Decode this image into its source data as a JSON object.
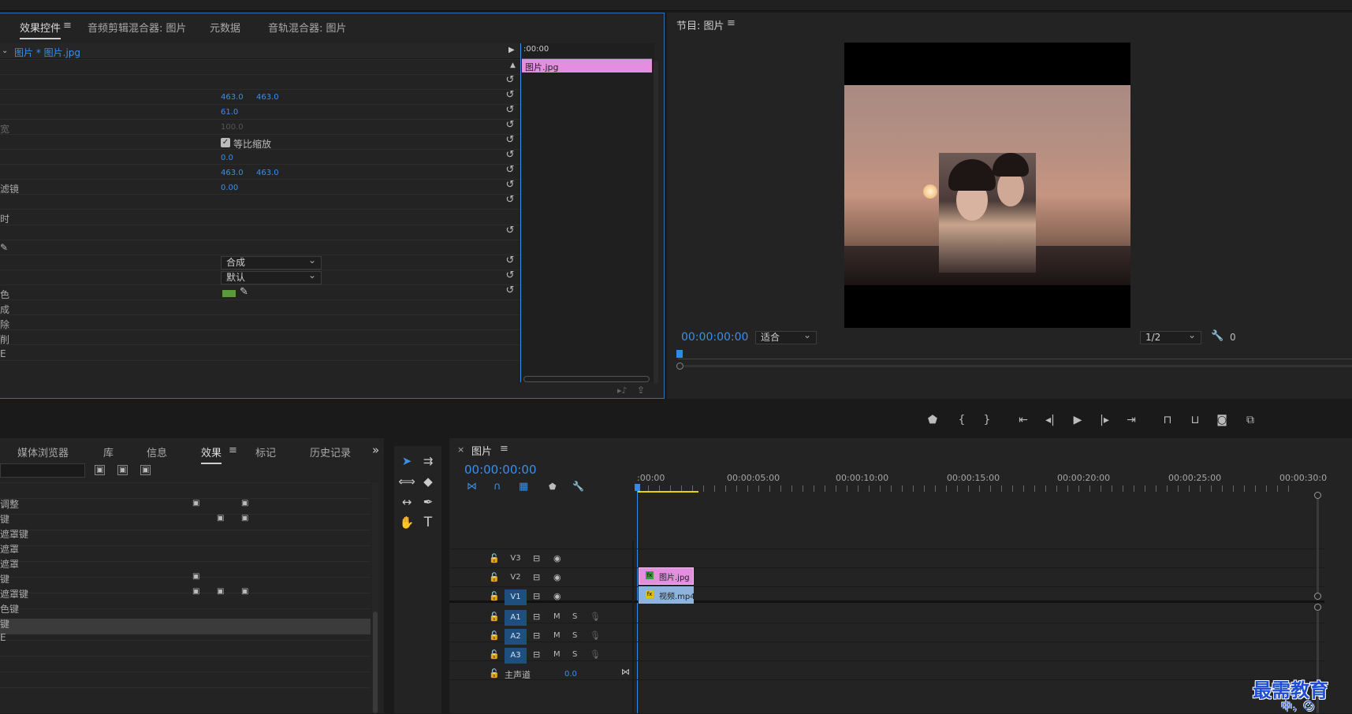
{
  "effect_controls": {
    "tabs": [
      "效果控件",
      "音频剪辑混合器: 图片",
      "元数据",
      "音轨混合器: 图片"
    ],
    "clip_header": "图片 * 图片.jpg",
    "timeline_time": ":00:00",
    "clip_label": "图片.jpg",
    "values": {
      "position_x": "463.0",
      "position_y": "463.0",
      "scale": "61.0",
      "scale_width": "100.0",
      "uniform_scale": "等比缩放",
      "rotation": "0.0",
      "anchor_x": "463.0",
      "anchor_y": "463.0",
      "anti_flicker": "0.00"
    },
    "cut_labels": [
      "宽",
      "滤镜",
      "时",
      "色",
      "成",
      "除",
      "削",
      "E"
    ],
    "dropdowns": {
      "blend_mode": "合成",
      "default": "默认"
    },
    "key_color": "#5a9a3a"
  },
  "program_monitor": {
    "title": "节目: 图片",
    "timecode": "00:00:00:00",
    "fit": "适合",
    "resolution": "1/2",
    "extra": "0"
  },
  "lower_left": {
    "tabs": [
      "媒体浏览器",
      "库",
      "信息",
      "效果",
      "标记",
      "历史记录"
    ],
    "more": "»",
    "items": [
      "调整",
      "键",
      "遮罩键",
      "遮罩",
      "遮罩",
      "键",
      "遮罩键",
      "色键",
      "键",
      "E"
    ]
  },
  "timeline": {
    "tab_label": "图片",
    "timecode": "00:00:00:00",
    "ruler": [
      ":00:00",
      "00:00:05:00",
      "00:00:10:00",
      "00:00:15:00",
      "00:00:20:00",
      "00:00:25:00",
      "00:00:30:0"
    ],
    "video_tracks": [
      "V3",
      "V2",
      "V1"
    ],
    "audio_tracks": [
      "A1",
      "A2",
      "A3"
    ],
    "master_label": "主声道",
    "master_value": "0.0",
    "clip_v2": "图片.jpg",
    "clip_v1": "视频.mp4",
    "m_label": "M",
    "s_label": "S"
  },
  "watermark": {
    "text": "最需教育",
    "subtext": "中，☺"
  },
  "colors": {
    "accent_blue": "#2d8ceb",
    "clip_pink": "#e48ee0",
    "clip_blue": "#8eb4de",
    "track_blue": "#1f4f7e"
  }
}
